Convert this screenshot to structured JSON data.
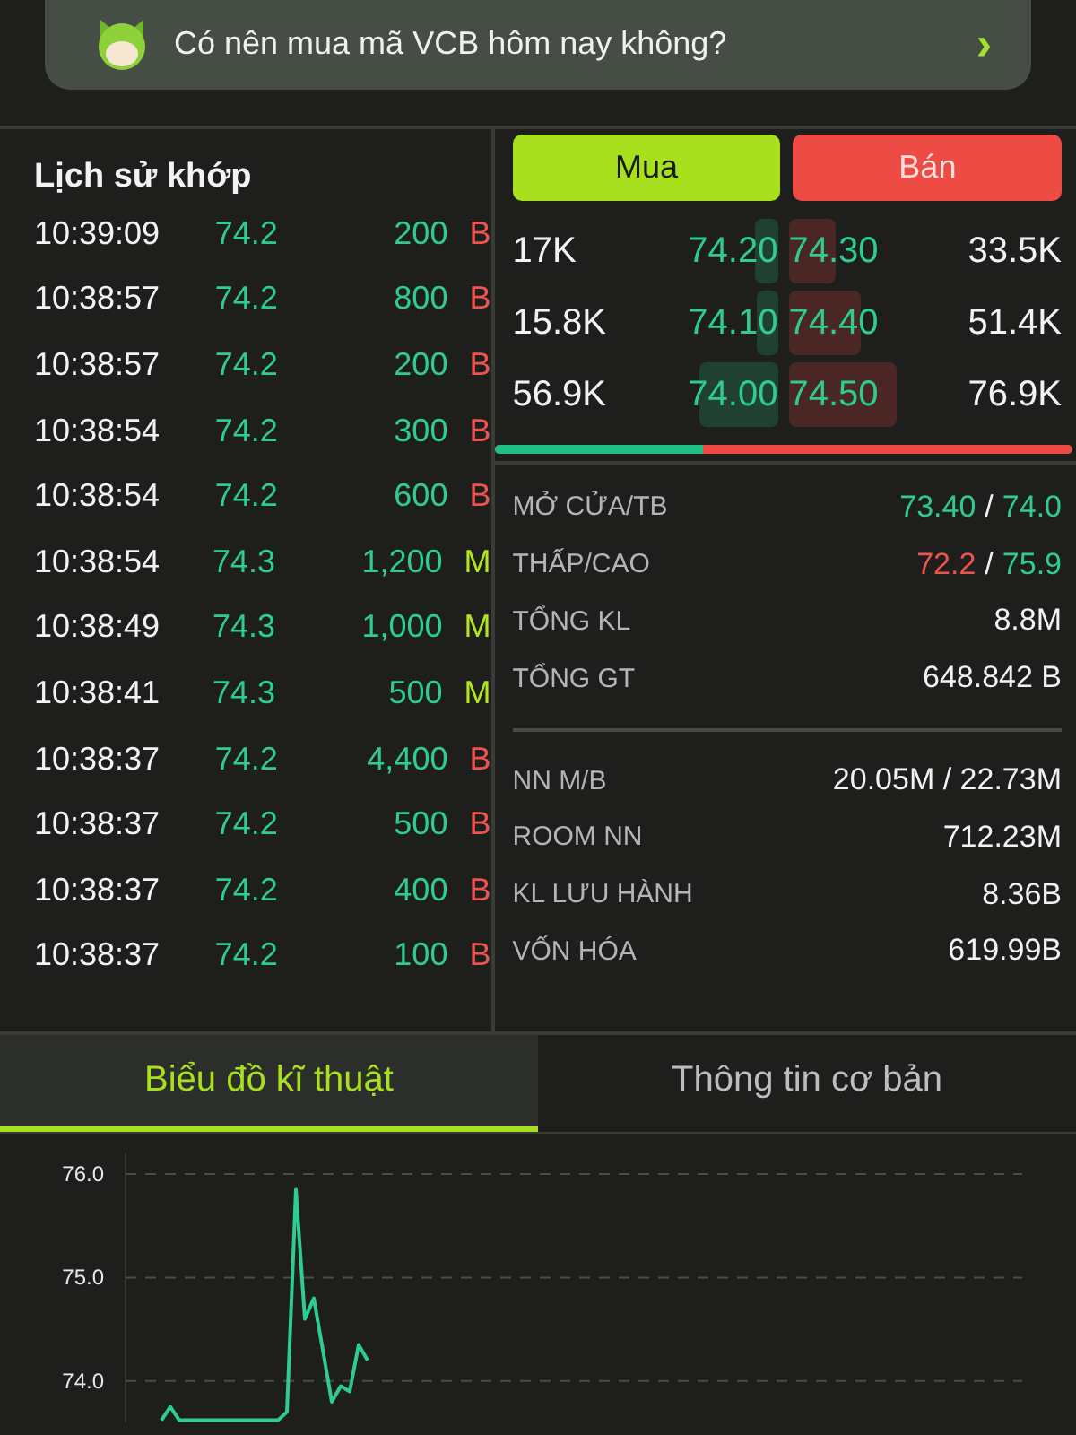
{
  "banner": {
    "question": "Có nên mua mã VCB hôm nay không?",
    "arrow": "›"
  },
  "trade_history": {
    "title": "Lịch sử khớp",
    "rows": [
      {
        "time": "10:39:09",
        "price": "74.2",
        "volume": "200",
        "side": "B"
      },
      {
        "time": "10:38:57",
        "price": "74.2",
        "volume": "800",
        "side": "B"
      },
      {
        "time": "10:38:57",
        "price": "74.2",
        "volume": "200",
        "side": "B"
      },
      {
        "time": "10:38:54",
        "price": "74.2",
        "volume": "300",
        "side": "B"
      },
      {
        "time": "10:38:54",
        "price": "74.2",
        "volume": "600",
        "side": "B"
      },
      {
        "time": "10:38:54",
        "price": "74.3",
        "volume": "1,200",
        "side": "M"
      },
      {
        "time": "10:38:49",
        "price": "74.3",
        "volume": "1,000",
        "side": "M"
      },
      {
        "time": "10:38:41",
        "price": "74.3",
        "volume": "500",
        "side": "M"
      },
      {
        "time": "10:38:37",
        "price": "74.2",
        "volume": "4,400",
        "side": "B"
      },
      {
        "time": "10:38:37",
        "price": "74.2",
        "volume": "500",
        "side": "B"
      },
      {
        "time": "10:38:37",
        "price": "74.2",
        "volume": "400",
        "side": "B"
      },
      {
        "time": "10:38:37",
        "price": "74.2",
        "volume": "100",
        "side": "B"
      }
    ]
  },
  "order_book": {
    "buy_button": "Mua",
    "sell_button": "Bán",
    "rows": [
      {
        "bid": {
          "volume": "17K",
          "price": "74.20"
        },
        "ask": {
          "price": "74.30",
          "volume": "33.5K"
        }
      },
      {
        "bid": {
          "volume": "15.8K",
          "price": "74.10"
        },
        "ask": {
          "price": "74.40",
          "volume": "51.4K"
        }
      },
      {
        "bid": {
          "volume": "56.9K",
          "price": "74.00"
        },
        "ask": {
          "price": "74.50",
          "volume": "76.9K"
        }
      }
    ],
    "balance": {
      "level": 0.36
    }
  },
  "stats": [
    [
      {
        "label": "MỞ CỬA/TB",
        "value": [
          {
            "text": "73.40",
            "color": "#2ecc8f"
          },
          {
            "text": "/",
            "color": "#f2f2f2"
          },
          {
            "text": "74.0",
            "color": "#2ecc8f"
          }
        ]
      },
      {
        "label": "THẤP/CAO",
        "value": [
          {
            "text": "72.2",
            "color": "#ef5350"
          },
          {
            "text": "/",
            "color": "#f2f2f2"
          },
          {
            "text": "75.9",
            "color": "#2ecc8f"
          }
        ]
      },
      {
        "label": "TỔNG KL",
        "value": [
          {
            "text": "8.8M",
            "color": "#f2f2f2"
          }
        ]
      },
      {
        "label": "TỔNG GT",
        "value": [
          {
            "text": "648.842 B",
            "color": "#f2f2f2"
          }
        ]
      }
    ],
    [
      {
        "label": "NN M/B",
        "value": [
          {
            "text": "20.05M / 22.73M",
            "color": "#f2f2f2"
          }
        ]
      },
      {
        "label": "ROOM NN",
        "value": [
          {
            "text": "712.23M",
            "color": "#f2f2f2"
          }
        ]
      },
      {
        "label": "KL LƯU HÀNH",
        "value": [
          {
            "text": "8.36B",
            "color": "#f2f2f2"
          }
        ]
      },
      {
        "label": "VỐN HÓA",
        "value": [
          {
            "text": "619.99B",
            "color": "#f2f2f2"
          }
        ]
      }
    ]
  ],
  "tabs": [
    {
      "label": "Biểu đồ kĩ thuật",
      "selected": true
    },
    {
      "label": "Thông tin cơ bản",
      "selected": false
    }
  ],
  "chart": {
    "chart_data": {
      "type": "line",
      "grid": true,
      "ylim": [
        73.6,
        76.2
      ],
      "yticks": [
        {
          "value": 76,
          "label": "76.0"
        },
        {
          "value": 75,
          "label": "75.0"
        },
        {
          "value": 74,
          "label": "74.0"
        }
      ],
      "categories": [
        null,
        null,
        null,
        null,
        null,
        null,
        null,
        null,
        null,
        null,
        null,
        null,
        null,
        null,
        null,
        null,
        null,
        null,
        null,
        null,
        null,
        null,
        null,
        null,
        null,
        null,
        null,
        null,
        null,
        null,
        null,
        null,
        null,
        null,
        null,
        null,
        null,
        null,
        null,
        null,
        null,
        null,
        null,
        null,
        null,
        null,
        null,
        null,
        null,
        null,
        null,
        null,
        null,
        null,
        null,
        null,
        null,
        null,
        null,
        null,
        null,
        null,
        null,
        null,
        null,
        null,
        null,
        null,
        null,
        null,
        null,
        null,
        null,
        null,
        null,
        null,
        null,
        null,
        null,
        null,
        null,
        null,
        null,
        null,
        null,
        null,
        null,
        null,
        null,
        null,
        null,
        null,
        null,
        null,
        null,
        null,
        null,
        null,
        null,
        null,
        null
      ],
      "series": [
        {
          "color": "#2ecc8f",
          "values": [
            null,
            null,
            null,
            null,
            73.62,
            73.75,
            73.62,
            73.62,
            73.62,
            73.62,
            73.62,
            73.62,
            73.62,
            73.62,
            73.62,
            73.62,
            73.62,
            73.62,
            73.7,
            75.85,
            74.6,
            74.8,
            74.3,
            73.8,
            73.95,
            73.9,
            74.35,
            74.2,
            null,
            null,
            null,
            null,
            null,
            null,
            null,
            null,
            null,
            null,
            null,
            null,
            null,
            null,
            null,
            null,
            null,
            null,
            null,
            null,
            null,
            null,
            null,
            null,
            null,
            null,
            null,
            null,
            null,
            null,
            null,
            null,
            null,
            null,
            null,
            null,
            null,
            null,
            null,
            null,
            null,
            null,
            null,
            null,
            null,
            null,
            null,
            null,
            null,
            null,
            null,
            null,
            null,
            null,
            null,
            null,
            null,
            null,
            null,
            null,
            null,
            null,
            null,
            null,
            null,
            null,
            null,
            null,
            null,
            null,
            null,
            null,
            null
          ]
        }
      ]
    }
  }
}
